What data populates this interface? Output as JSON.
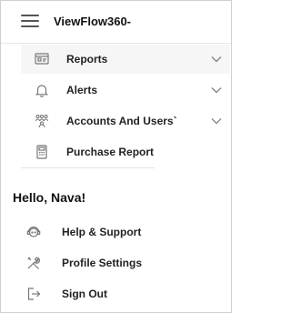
{
  "header": {
    "app_title": "ViewFlow360-",
    "menu_icon": "hamburger-menu-icon"
  },
  "menu": {
    "items": [
      {
        "label": "Reports",
        "icon": "report-icon",
        "expandable": true
      },
      {
        "label": "Alerts",
        "icon": "bell-icon",
        "expandable": true
      },
      {
        "label": "Accounts And Users`",
        "icon": "users-icon",
        "expandable": true
      },
      {
        "label": "Purchase Report",
        "icon": "calculator-icon",
        "expandable": false
      }
    ]
  },
  "user": {
    "greeting": "Hello, Nava!"
  },
  "account_menu": {
    "items": [
      {
        "label": "Help & Support",
        "icon": "support-icon"
      },
      {
        "label": "Profile Settings",
        "icon": "tools-icon"
      },
      {
        "label": "Sign Out",
        "icon": "sign-out-icon"
      }
    ]
  },
  "colors": {
    "icon": "#777777",
    "text": "#222222",
    "active_bg": "#f6f6f6"
  }
}
